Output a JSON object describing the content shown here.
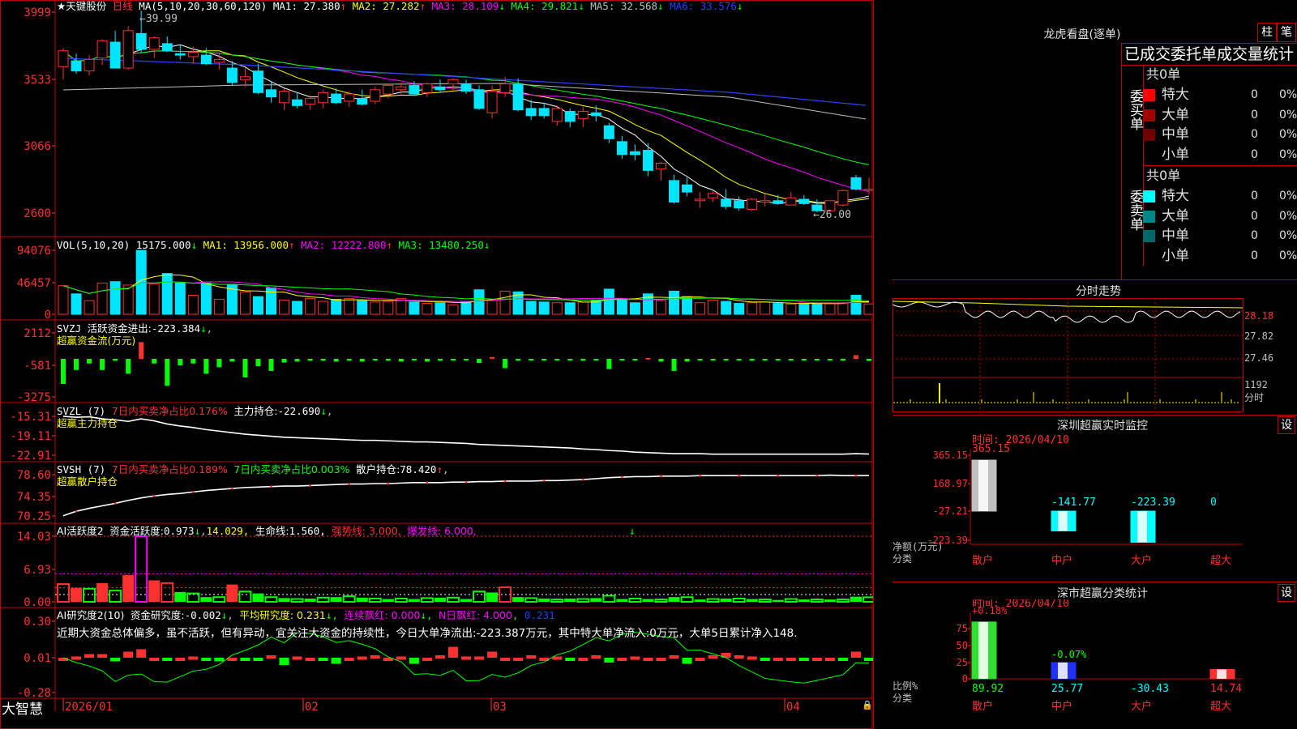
{
  "app": {
    "brand": "大智慧"
  },
  "main_header": {
    "stock": "★天键股份",
    "period": "日线",
    "ma_label": "MA(5,10,20,30,60,120)",
    "ma": [
      {
        "label": "MA1:",
        "value": "27.380",
        "arrow": "↑",
        "color": "#ffffff"
      },
      {
        "label": "MA2:",
        "value": "27.282",
        "arrow": "↑",
        "color": "#ffff00"
      },
      {
        "label": "MA3:",
        "value": "28.109",
        "arrow": "↓",
        "color": "#ff00ff"
      },
      {
        "label": "MA4:",
        "value": "29.821",
        "arrow": "↓",
        "color": "#00ff00"
      },
      {
        "label": "MA5:",
        "value": "32.568",
        "arrow": "↓",
        "color": "#c0c0c0"
      },
      {
        "label": "MA6:",
        "value": "33.576",
        "arrow": "↓",
        "color": "#2040ff"
      }
    ],
    "high_marker": "39.99",
    "low_marker": "26.00",
    "y_ticks": [
      "3999",
      "3533",
      "3066",
      "2600"
    ]
  },
  "vol_header": {
    "label": "VOL(5,10,20)",
    "value": "15175.000",
    "arrow": "↓",
    "ma": [
      {
        "label": "MA1:",
        "value": "13956.000",
        "arrow": "↑",
        "color": "#ffff00"
      },
      {
        "label": "MA2:",
        "value": "12222.800",
        "arrow": "↑",
        "color": "#ff00ff"
      },
      {
        "label": "MA3:",
        "value": "13480.250",
        "arrow": "↓",
        "color": "#00ff00"
      }
    ],
    "y_ticks": [
      "94076",
      "46457",
      "0"
    ]
  },
  "svzj": {
    "label": "SVZJ",
    "text": "活跃资金进出:",
    "value": "-223.384",
    "arrow": "↓",
    "sub": "超赢资金流(万元)",
    "y_ticks": [
      "2112",
      "-581",
      "-3275"
    ]
  },
  "svzl": {
    "label": "SVZL (7)",
    "red_text": "7日内买卖净占比0.176%",
    "text": "主力持仓:",
    "value": "-22.690",
    "arrow": "↓",
    "sub": "超赢主力持仓",
    "y_ticks": [
      "-15.31",
      "-19.11",
      "-22.91"
    ]
  },
  "svsh": {
    "label": "SVSH (7)",
    "red_text": "7日内买卖净占比0.189%",
    "green_text": "7日内买卖净占比0.003%",
    "text": "散户持仓:",
    "value": "78.420",
    "arrow": "↑",
    "sub": "超赢散户持仓",
    "y_ticks": [
      "78.60",
      "74.35",
      "70.25"
    ]
  },
  "ai_active": {
    "label": "AI活跃度2",
    "text": "资金活跃度:",
    "value": "0.973",
    "arrow": "↓",
    "v2": "14.029,",
    "v3_label": "生命线:",
    "v3": "1.560,",
    "strong": "强势线: 3.000,",
    "burst": "爆发线: 6.000,",
    "y_ticks": [
      "14.03",
      "6.93",
      "0.00"
    ]
  },
  "ai_research": {
    "label": "AI研究度2(10)",
    "text": "资金研究度:",
    "value": "-0.002",
    "arrow": "↓",
    "avg": "平均研究度: 0.231",
    "red_streak": "连续飘红: 0.000",
    "n_red": "N日飘红: 4.000",
    "extra": "0.231",
    "comment": "近期大资金总体偏多，虽不活跃，但有异动，宜关注大资金的持续性，今日大单净流出:-223.387万元，其中特大单净流入:0万元，大单5日累计净入148.",
    "y_ticks": [
      "0.30",
      "0.01",
      "-0.28"
    ]
  },
  "x_axis": [
    "2026/01",
    "02",
    "03",
    "04"
  ],
  "longhu": {
    "title": "龙虎看盘(逐单)",
    "tabs": [
      "柱",
      "笔"
    ],
    "stat_title": "已成交委托单成交量统计",
    "buy": {
      "side_label": "委买单",
      "count": "共0单",
      "rows": [
        {
          "label": "特大",
          "n": "0",
          "pct": "0%",
          "color": "#ff0000"
        },
        {
          "label": "大单",
          "n": "0",
          "pct": "0%",
          "color": "#a00000"
        },
        {
          "label": "中单",
          "n": "0",
          "pct": "0%",
          "color": "#700000"
        },
        {
          "label": "小单",
          "n": "0",
          "pct": "0%",
          "color": ""
        }
      ]
    },
    "sell": {
      "side_label": "委卖单",
      "count": "共0单",
      "rows": [
        {
          "label": "特大",
          "n": "0",
          "pct": "0%",
          "color": "#00ffff"
        },
        {
          "label": "大单",
          "n": "0",
          "pct": "0%",
          "color": "#008888"
        },
        {
          "label": "中单",
          "n": "0",
          "pct": "0%",
          "color": "#006868"
        },
        {
          "label": "小单",
          "n": "0",
          "pct": "0%",
          "color": ""
        }
      ]
    }
  },
  "intraday": {
    "title": "分时走势",
    "price_ticks": [
      "28.18",
      "27.82",
      "27.46"
    ],
    "vol_ticks": [
      "1192",
      "分时"
    ]
  },
  "sz_monitor": {
    "title": "深圳超赢实时监控",
    "settings": "设",
    "time": "时间: 2026/04/10",
    "y_ticks": [
      "365.15",
      "168.97",
      "-27.21",
      "-223.39"
    ],
    "ylabel": "净额(万元)",
    "xlabel": "分类",
    "categories": [
      "散户",
      "中户",
      "大户",
      "超大"
    ],
    "values": [
      365.15,
      -141.77,
      -223.39,
      0
    ],
    "value_labels": [
      "365.15",
      "-141.77",
      "-223.39",
      "0"
    ]
  },
  "sz_class": {
    "title": "深市超赢分类统计",
    "settings": "设",
    "time": "时间: 2026/04/10",
    "y_ticks": [
      "75",
      "50",
      "25",
      "0"
    ],
    "ylabel": "比例%",
    "xlabel": "分类",
    "categories": [
      "散户",
      "中户",
      "大户",
      "超大"
    ],
    "values": [
      89.92,
      25.77,
      -30.43,
      14.74
    ],
    "value_labels": [
      "89.92",
      "25.77",
      "-30.43",
      "14.74"
    ],
    "notes": [
      "+0.18%",
      "-0.07%"
    ]
  },
  "chart_data": [
    {
      "type": "candlestick",
      "x_ticks": [
        "2026/01",
        "02",
        "03",
        "04"
      ],
      "ohlc": [
        [
          36.1,
          37.4,
          35.2,
          37.2
        ],
        [
          36.5,
          37.0,
          35.6,
          35.8
        ],
        [
          35.8,
          36.9,
          35.5,
          36.6
        ],
        [
          36.7,
          38.0,
          36.2,
          37.9
        ],
        [
          37.8,
          38.6,
          36.0,
          36.0
        ],
        [
          36.0,
          38.9,
          35.9,
          38.6
        ],
        [
          38.4,
          39.99,
          37.1,
          37.3
        ],
        [
          37.3,
          38.2,
          36.7,
          38.1
        ],
        [
          37.7,
          38.2,
          37.1,
          37.2
        ],
        [
          37.0,
          37.6,
          36.6,
          36.9
        ],
        [
          36.8,
          37.5,
          36.3,
          37.1
        ],
        [
          36.9,
          37.4,
          36.2,
          36.3
        ],
        [
          36.4,
          37.0,
          35.9,
          36.6
        ],
        [
          36.0,
          36.5,
          34.8,
          35.0
        ],
        [
          35.2,
          36.0,
          34.7,
          35.4
        ],
        [
          35.8,
          36.3,
          34.2,
          34.3
        ],
        [
          34.5,
          35.1,
          33.6,
          34.0
        ],
        [
          33.6,
          34.6,
          33.1,
          34.4
        ],
        [
          33.8,
          34.3,
          33.2,
          33.4
        ],
        [
          33.5,
          34.1,
          33.1,
          33.9
        ],
        [
          33.6,
          34.5,
          33.2,
          34.3
        ],
        [
          34.2,
          34.6,
          33.5,
          33.6
        ],
        [
          33.7,
          34.4,
          33.3,
          34.2
        ],
        [
          33.9,
          34.5,
          33.4,
          33.5
        ],
        [
          33.7,
          34.7,
          33.5,
          34.5
        ],
        [
          34.2,
          34.9,
          33.9,
          34.8
        ],
        [
          34.5,
          35.0,
          34.2,
          34.7
        ],
        [
          34.8,
          35.1,
          34.1,
          34.2
        ],
        [
          34.3,
          35.0,
          34.0,
          34.9
        ],
        [
          34.7,
          35.2,
          34.3,
          34.5
        ],
        [
          34.9,
          35.3,
          34.4,
          35.2
        ],
        [
          34.9,
          35.2,
          34.2,
          34.4
        ],
        [
          34.5,
          34.8,
          33.1,
          33.2
        ],
        [
          32.9,
          34.8,
          32.5,
          34.4
        ],
        [
          34.3,
          35.4,
          34.0,
          34.9
        ],
        [
          34.9,
          35.3,
          33.0,
          33.1
        ],
        [
          33.2,
          33.8,
          32.4,
          32.7
        ],
        [
          33.2,
          33.6,
          32.5,
          32.7
        ],
        [
          32.3,
          33.4,
          32.0,
          33.2
        ],
        [
          33.0,
          33.2,
          31.9,
          32.3
        ],
        [
          32.5,
          33.3,
          31.9,
          33.0
        ],
        [
          32.9,
          33.4,
          32.3,
          32.7
        ],
        [
          32.0,
          32.2,
          30.8,
          31.1
        ],
        [
          30.9,
          31.3,
          29.7,
          30.0
        ],
        [
          30.2,
          30.7,
          29.6,
          30.0
        ],
        [
          30.3,
          30.8,
          28.5,
          28.9
        ],
        [
          29.0,
          29.5,
          28.2,
          29.4
        ],
        [
          28.2,
          28.6,
          26.6,
          26.7
        ],
        [
          27.9,
          28.4,
          27.1,
          27.4
        ],
        [
          26.8,
          27.4,
          26.3,
          26.9
        ],
        [
          27.0,
          27.5,
          26.7,
          27.3
        ],
        [
          26.9,
          27.6,
          26.2,
          26.4
        ],
        [
          26.8,
          27.1,
          26.1,
          26.3
        ],
        [
          26.2,
          27.0,
          26.1,
          26.9
        ],
        [
          26.7,
          27.3,
          26.4,
          26.8
        ],
        [
          26.8,
          27.2,
          26.5,
          26.6
        ],
        [
          26.5,
          27.4,
          26.5,
          27.0
        ],
        [
          26.9,
          27.2,
          26.5,
          26.6
        ],
        [
          26.5,
          26.9,
          26.0,
          26.1
        ],
        [
          26.1,
          26.8,
          26.0,
          26.8
        ],
        [
          26.5,
          27.6,
          26.4,
          27.5
        ],
        [
          28.4,
          28.6,
          27.5,
          27.6
        ],
        [
          27.5,
          28.4,
          27.2,
          27.6
        ]
      ]
    },
    {
      "type": "bar",
      "name": "VOL",
      "values": [
        42000,
        30000,
        20000,
        46000,
        48000,
        43000,
        94076,
        45000,
        60000,
        46000,
        28000,
        46000,
        22000,
        44000,
        33000,
        26000,
        39000,
        21000,
        19000,
        23000,
        19000,
        22000,
        23000,
        20000,
        18000,
        19000,
        23000,
        18000,
        16000,
        17000,
        14000,
        19000,
        36000,
        21000,
        34000,
        33000,
        19000,
        18000,
        17000,
        17000,
        18000,
        21000,
        37000,
        21000,
        17000,
        30000,
        20000,
        34000,
        26000,
        17000,
        21000,
        19000,
        16000,
        17000,
        18000,
        16000,
        15000,
        15000,
        16000,
        16000,
        17000,
        28000,
        15175
      ]
    },
    {
      "type": "bar",
      "name": "SVZJ",
      "values": [
        -2700,
        -1200,
        -500,
        -1200,
        -200,
        -1600,
        1800,
        -500,
        -2900,
        -700,
        -500,
        -1600,
        -900,
        -300,
        -2000,
        -800,
        -1300,
        -400,
        -300,
        -200,
        -200,
        -300,
        -200,
        -300,
        -150,
        -200,
        -300,
        -100,
        -300,
        -200,
        -150,
        -150,
        -450,
        200,
        -1000,
        -200,
        -100,
        -100,
        -100,
        -150,
        -200,
        -150,
        -1100,
        -100,
        -150,
        100,
        -300,
        -1300,
        -300,
        -100,
        -150,
        -150,
        -100,
        -200,
        -150,
        -100,
        -100,
        -150,
        -100,
        -100,
        -200,
        400,
        -223
      ]
    },
    {
      "type": "line",
      "name": "主力持仓",
      "values": [
        -15.3,
        -15.5,
        -15.4,
        -15.8,
        -16.0,
        -16.3,
        -15.8,
        -16.2,
        -16.8,
        -17.2,
        -17.5,
        -17.9,
        -18.2,
        -18.5,
        -18.8,
        -19.0,
        -19.2,
        -19.4,
        -19.5,
        -19.6,
        -19.7,
        -19.8,
        -19.9,
        -20.0,
        -20.0,
        -20.1,
        -20.2,
        -20.3,
        -20.3,
        -20.4,
        -20.5,
        -20.6,
        -20.8,
        -20.9,
        -21.0,
        -21.1,
        -21.2,
        -21.3,
        -21.4,
        -21.5,
        -21.7,
        -21.8,
        -22.0,
        -22.1,
        -22.3,
        -22.4,
        -22.5,
        -22.6,
        -22.6,
        -22.6,
        -22.7,
        -22.7,
        -22.7,
        -22.7,
        -22.7,
        -22.7,
        -22.7,
        -22.7,
        -22.7,
        -22.7,
        -22.7,
        -22.6,
        -22.69
      ]
    },
    {
      "type": "line",
      "name": "散户持仓",
      "values": [
        70.3,
        71.2,
        71.8,
        72.3,
        72.8,
        73.4,
        73.9,
        74.3,
        74.6,
        74.8,
        75.1,
        75.4,
        75.6,
        75.8,
        76.0,
        76.1,
        76.2,
        76.3,
        76.3,
        76.4,
        76.5,
        76.6,
        76.7,
        76.7,
        76.8,
        76.8,
        76.9,
        77.0,
        77.0,
        77.0,
        77.1,
        77.1,
        77.2,
        77.2,
        77.3,
        77.3,
        77.3,
        77.4,
        77.4,
        77.5,
        77.6,
        77.8,
        78.0,
        78.1,
        78.2,
        78.2,
        78.3,
        78.3,
        78.3,
        78.4,
        78.4,
        78.4,
        78.4,
        78.4,
        78.4,
        78.4,
        78.4,
        78.4,
        78.4,
        78.5,
        78.4,
        78.4,
        78.42
      ]
    },
    {
      "type": "bar",
      "name": "资金活跃度",
      "values": [
        3.8,
        3.0,
        2.8,
        4.0,
        2.4,
        5.7,
        14.03,
        4.6,
        4.0,
        2.1,
        1.8,
        1.0,
        1.0,
        3.7,
        2.2,
        1.8,
        1.0,
        0.8,
        0.6,
        0.7,
        0.9,
        1.0,
        1.2,
        0.9,
        0.7,
        0.6,
        0.7,
        0.6,
        0.8,
        0.9,
        0.9,
        0.6,
        2.2,
        2.0,
        3.1,
        1.0,
        0.8,
        0.7,
        0.5,
        0.7,
        0.6,
        0.8,
        1.3,
        0.6,
        0.7,
        0.6,
        0.5,
        1.0,
        1.0,
        0.5,
        0.6,
        0.7,
        0.7,
        0.6,
        0.5,
        0.4,
        0.6,
        0.5,
        0.5,
        0.5,
        0.5,
        1.1,
        0.97
      ]
    },
    {
      "type": "bar",
      "name": "资金研究度",
      "values": [
        0.0,
        0.01,
        0.03,
        0.03,
        -0.03,
        0.05,
        0.07,
        0.0,
        -0.02,
        0.0,
        0.01,
        -0.02,
        -0.03,
        0.0,
        -0.01,
        -0.01,
        0.02,
        -0.06,
        0.01,
        0.0,
        -0.02,
        -0.05,
        0.0,
        0.01,
        0.02,
        0.0,
        0.01,
        -0.05,
        0.0,
        0.02,
        0.09,
        0.01,
        0.01,
        0.05,
        0.0,
        0.0,
        0.02,
        0.0,
        0.01,
        -0.01,
        0.0,
        0.02,
        -0.04,
        0.0,
        0.01,
        0.0,
        0.0,
        0.02,
        -0.05,
        0.0,
        0.02,
        0.04,
        0.02,
        0.01,
        -0.01,
        0.0,
        0.0,
        -0.01,
        0.0,
        0.0,
        -0.01,
        0.05,
        -0.002
      ]
    }
  ]
}
